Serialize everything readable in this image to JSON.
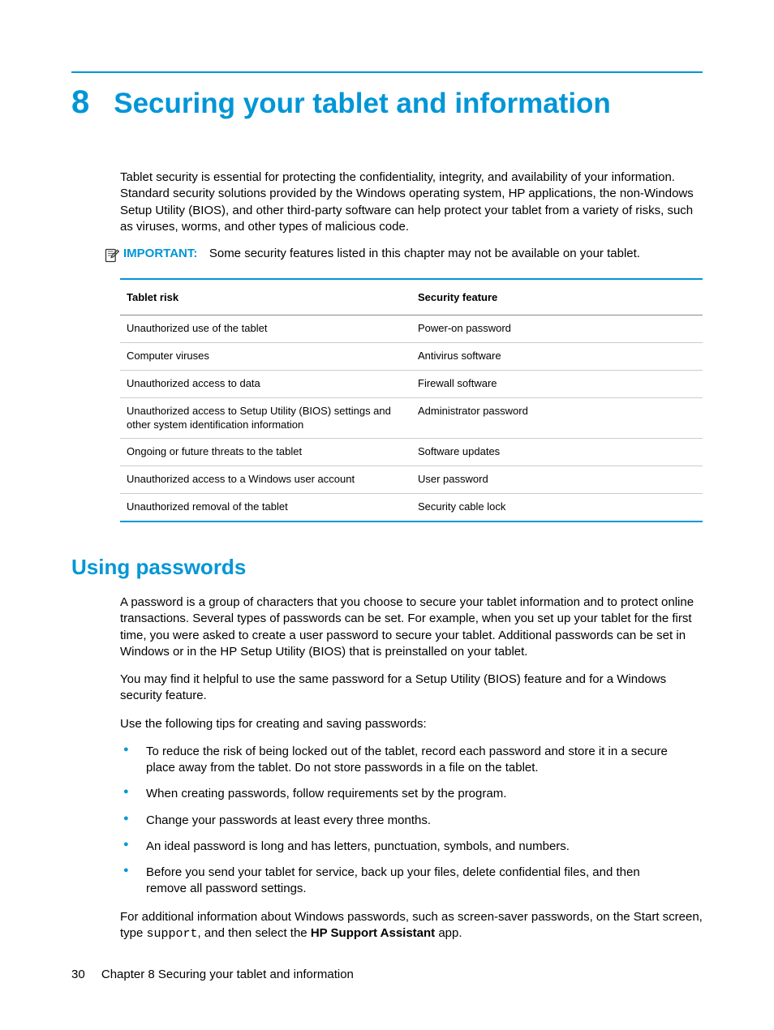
{
  "chapter": {
    "number": "8",
    "title": "Securing your tablet and information"
  },
  "intro": "Tablet security is essential for protecting the confidentiality, integrity, and availability of your information. Standard security solutions provided by the Windows operating system, HP applications, the non-Windows Setup Utility (BIOS), and other third-party software can help protect your tablet from a variety of risks, such as viruses, worms, and other types of malicious code.",
  "important": {
    "label": "IMPORTANT:",
    "text": "Some security features listed in this chapter may not be available on your tablet."
  },
  "table": {
    "headers": {
      "col1": "Tablet risk",
      "col2": "Security feature"
    },
    "rows": [
      {
        "risk": "Unauthorized use of the tablet",
        "feature": "Power-on password"
      },
      {
        "risk": "Computer viruses",
        "feature": "Antivirus software"
      },
      {
        "risk": "Unauthorized access to data",
        "feature": "Firewall software"
      },
      {
        "risk": "Unauthorized access to Setup Utility (BIOS) settings and other system identification information",
        "feature": "Administrator password"
      },
      {
        "risk": "Ongoing or future threats to the tablet",
        "feature": "Software updates"
      },
      {
        "risk": "Unauthorized access to a Windows user account",
        "feature": "User password"
      },
      {
        "risk": "Unauthorized removal of the tablet",
        "feature": "Security cable lock"
      }
    ]
  },
  "section": {
    "heading": "Using passwords",
    "p1": "A password is a group of characters that you choose to secure your tablet information and to protect online transactions. Several types of passwords can be set. For example, when you set up your tablet for the first time, you were asked to create a user password to secure your tablet. Additional passwords can be set in Windows or in the HP Setup Utility (BIOS) that is preinstalled on your tablet.",
    "p2": "You may find it helpful to use the same password for a Setup Utility (BIOS) feature and for a Windows security feature.",
    "p3": "Use the following tips for creating and saving passwords:",
    "tips": [
      "To reduce the risk of being locked out of the tablet, record each password and store it in a secure place away from the tablet. Do not store passwords in a file on the tablet.",
      "When creating passwords, follow requirements set by the program.",
      "Change your passwords at least every three months.",
      "An ideal password is long and has letters, punctuation, symbols, and numbers.",
      "Before you send your tablet for service, back up your files, delete confidential files, and then remove all password settings."
    ],
    "p4_pre": "For additional information about Windows passwords, such as screen-saver passwords, on the Start screen, type ",
    "p4_code": "support",
    "p4_mid": ", and then select the ",
    "p4_bold": "HP Support Assistant",
    "p4_post": " app."
  },
  "footer": {
    "page": "30",
    "text": "Chapter 8   Securing your tablet and information"
  }
}
